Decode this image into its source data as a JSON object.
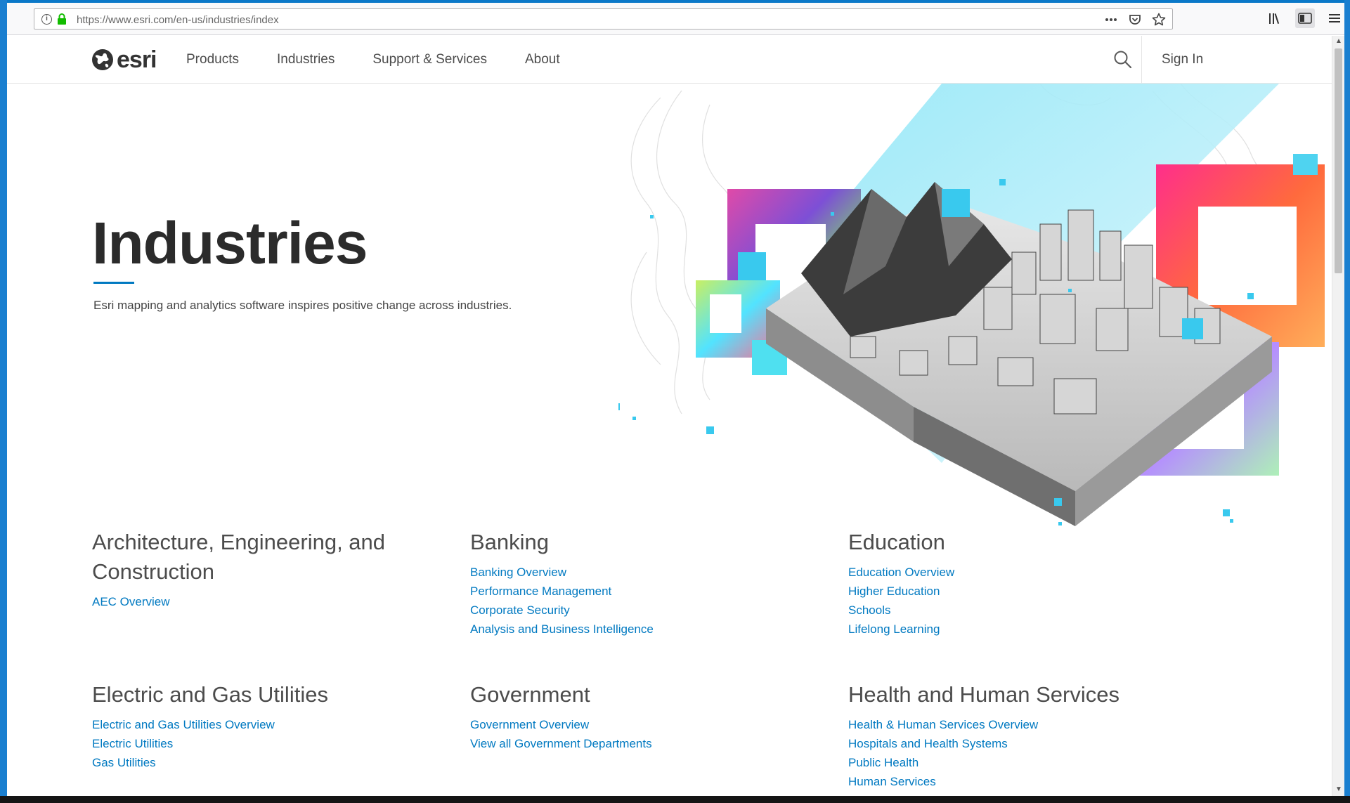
{
  "browser": {
    "url": "https://www.esri.com/en-us/industries/index"
  },
  "site": {
    "logo_text": "esri",
    "nav": [
      "Products",
      "Industries",
      "Support & Services",
      "About"
    ],
    "sign_in": "Sign In"
  },
  "hero": {
    "title": "Industries",
    "subtitle": "Esri mapping and analytics software inspires positive change across industries."
  },
  "categories": [
    {
      "title": "Architecture, Engineering, and Construction",
      "links": [
        "AEC Overview"
      ]
    },
    {
      "title": "Banking",
      "links": [
        "Banking Overview",
        "Performance Management",
        "Corporate Security",
        "Analysis and Business Intelligence"
      ]
    },
    {
      "title": "Education",
      "links": [
        "Education Overview",
        "Higher Education",
        "Schools",
        "Lifelong Learning"
      ]
    },
    {
      "title": "Electric and Gas Utilities",
      "links": [
        "Electric and Gas Utilities Overview",
        "Electric Utilities",
        "Gas Utilities"
      ]
    },
    {
      "title": "Government",
      "links": [
        "Government Overview",
        "View all Government Departments"
      ]
    },
    {
      "title": "Health and Human Services",
      "links": [
        "Health & Human Services Overview",
        "Hospitals and Health Systems",
        "Public Health",
        "Human Services"
      ]
    }
  ],
  "colors": {
    "link": "#0079c1",
    "accent": "#0079c1",
    "heading": "#2b2b2b"
  }
}
